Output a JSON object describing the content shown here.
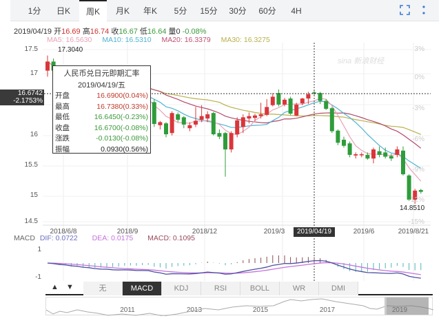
{
  "tabs": [
    "1分",
    "日K",
    "周K",
    "月K",
    "年K",
    "5分",
    "15分",
    "30分",
    "60分",
    "4H"
  ],
  "active_tab": "周K",
  "icons": {
    "fullscreen": "fullscreen-icon",
    "more": "more-vertical-icon"
  },
  "info": {
    "date": "2019/04/19",
    "open_label": "开",
    "open": "16.69",
    "high_label": "高",
    "high": "16.74",
    "close_label": "收",
    "close": "16.67",
    "low_label": "低",
    "low": "16.64",
    "vol_label": "量",
    "vol": "0",
    "change": "-0.08%"
  },
  "ma": {
    "ma5": "MA5: 16.5630",
    "ma10": "MA10: 16.5310",
    "ma20": "MA20: 16.3379",
    "ma30": "MA30: 16.3275"
  },
  "colors": {
    "up": "#d9363a",
    "down": "#2e9c3a",
    "ma5": "#e8a3b5",
    "ma10": "#4fb3d1",
    "ma20": "#b24a6a",
    "ma30": "#b8b04a",
    "dif": "#4b4f9e",
    "dea": "#c572dc"
  },
  "y_axis": [
    "17.5",
    "17",
    "16",
    "15.5",
    "15",
    "14.5"
  ],
  "pct_axis": [
    "3%",
    "0%",
    "-3%",
    "-6%",
    "-9%",
    "-12%",
    "-15%"
  ],
  "x_axis": [
    "2018/6/8",
    "2018/9",
    "2018/12",
    "2019/3",
    "2019/6",
    "2019/8/21"
  ],
  "crosshair_date": "2019/04/19",
  "price_tag": {
    "price": "16.6742",
    "pct": "-2.1753%"
  },
  "max_label": "17.3040",
  "min_label": "14.8510",
  "watermark": "sina 新浪财经",
  "tooltip": {
    "title": "人民币兑日元即期汇率",
    "date": "2019/04/19/五",
    "rows": [
      {
        "k": "开盘",
        "v": "16.6900(0.04%)"
      },
      {
        "k": "最高",
        "v": "16.7380(0.33%)"
      },
      {
        "k": "最低",
        "v": "16.6450(-0.23%)"
      },
      {
        "k": "收盘",
        "v": "16.6700(-0.08%)"
      },
      {
        "k": "涨跌",
        "v": "-0.0130(-0.08%)"
      },
      {
        "k": "振幅",
        "v": "0.0930(0.56%)"
      }
    ]
  },
  "macd_legend": {
    "name": "MACD",
    "dif": "DIF: 0.0722",
    "dea": "DEA: 0.0175",
    "macd": "MACD: 0.1095"
  },
  "macd_axis": [
    "1",
    "-1"
  ],
  "indicator_tabs": [
    "无",
    "MACD",
    "KDJ",
    "RSI",
    "BOLL",
    "WR",
    "DMI"
  ],
  "active_indicator": "MACD",
  "nav_years": [
    "2011",
    "2013",
    "2015",
    "2017",
    "2019"
  ],
  "chart_data": {
    "type": "candlestick",
    "title": "人民币兑日元即期汇率 周K",
    "ylim": [
      14.5,
      17.5
    ],
    "candles": [
      [
        17.05,
        17.3,
        16.95,
        17.2
      ],
      [
        17.2,
        17.25,
        17.0,
        17.05
      ],
      [
        17.05,
        17.1,
        16.9,
        16.95
      ],
      [
        16.95,
        17.05,
        16.85,
        17.0
      ],
      [
        17.0,
        17.05,
        16.8,
        16.85
      ],
      [
        16.85,
        16.95,
        16.75,
        16.9
      ],
      [
        16.9,
        16.95,
        16.7,
        16.75
      ],
      [
        16.75,
        16.85,
        16.65,
        16.8
      ],
      [
        16.8,
        16.85,
        16.6,
        16.65
      ],
      [
        16.65,
        16.75,
        16.55,
        16.7
      ],
      [
        16.7,
        16.8,
        16.6,
        16.75
      ],
      [
        16.75,
        16.8,
        16.55,
        16.6
      ],
      [
        16.6,
        16.7,
        16.5,
        16.65
      ],
      [
        16.65,
        16.75,
        16.55,
        16.7
      ],
      [
        16.7,
        16.75,
        16.55,
        16.6
      ],
      [
        16.6,
        16.68,
        16.45,
        16.5
      ],
      [
        16.5,
        16.62,
        16.45,
        16.58
      ],
      [
        16.58,
        16.65,
        16.5,
        16.53
      ],
      [
        16.53,
        16.58,
        16.12,
        16.17
      ],
      [
        16.15,
        16.22,
        16.08,
        16.2
      ],
      [
        16.18,
        16.2,
        15.95,
        16.0
      ],
      [
        16.02,
        16.38,
        15.98,
        16.35
      ],
      [
        16.33,
        16.36,
        16.2,
        16.24
      ],
      [
        16.28,
        16.3,
        16.1,
        16.16
      ],
      [
        16.1,
        16.2,
        16.05,
        16.15
      ],
      [
        16.16,
        16.45,
        16.12,
        16.22
      ],
      [
        16.24,
        16.48,
        16.2,
        16.3
      ],
      [
        16.26,
        16.38,
        16.2,
        16.33
      ],
      [
        16.35,
        16.37,
        15.98,
        16.0
      ],
      [
        16.02,
        16.08,
        15.92,
        15.96
      ],
      [
        16.02,
        16.04,
        15.3,
        15.75
      ],
      [
        15.75,
        16.05,
        15.7,
        16.02
      ],
      [
        16.0,
        16.28,
        15.95,
        16.23
      ],
      [
        16.12,
        16.33,
        16.02,
        16.28
      ],
      [
        16.26,
        16.36,
        16.18,
        16.3
      ],
      [
        16.27,
        16.34,
        16.22,
        16.31
      ],
      [
        16.3,
        16.52,
        16.26,
        16.33
      ],
      [
        16.32,
        16.58,
        16.3,
        16.45
      ],
      [
        16.48,
        16.68,
        16.46,
        16.62
      ],
      [
        16.68,
        16.74,
        16.46,
        16.49
      ],
      [
        16.49,
        16.6,
        16.46,
        16.57
      ],
      [
        16.59,
        16.62,
        16.32,
        16.34
      ],
      [
        16.31,
        16.52,
        16.3,
        16.49
      ],
      [
        16.51,
        16.6,
        16.48,
        16.59
      ],
      [
        16.59,
        16.7,
        16.5,
        16.66
      ],
      [
        16.69,
        16.738,
        16.645,
        16.67
      ],
      [
        16.68,
        16.7,
        16.5,
        16.55
      ],
      [
        16.55,
        16.58,
        16.4,
        16.42
      ],
      [
        16.43,
        16.45,
        16.02,
        16.05
      ],
      [
        16.06,
        16.08,
        15.82,
        15.86
      ],
      [
        15.91,
        15.96,
        15.78,
        15.81
      ],
      [
        15.85,
        15.88,
        15.62,
        15.66
      ],
      [
        15.65,
        15.7,
        15.6,
        15.67
      ],
      [
        15.66,
        15.7,
        15.62,
        15.67
      ],
      [
        15.66,
        15.7,
        15.58,
        15.6
      ],
      [
        15.6,
        15.78,
        15.52,
        15.75
      ],
      [
        15.72,
        15.8,
        15.62,
        15.66
      ],
      [
        15.7,
        15.78,
        15.6,
        15.63
      ],
      [
        15.64,
        15.68,
        15.56,
        15.6
      ],
      [
        15.66,
        15.8,
        15.62,
        15.75
      ],
      [
        15.73,
        15.8,
        15.32,
        15.34
      ],
      [
        15.32,
        15.34,
        14.9,
        14.92
      ],
      [
        14.92,
        15.1,
        14.851,
        15.07
      ],
      [
        15.08,
        15.1,
        15.02,
        15.05
      ]
    ],
    "crosshair_index": 45
  }
}
